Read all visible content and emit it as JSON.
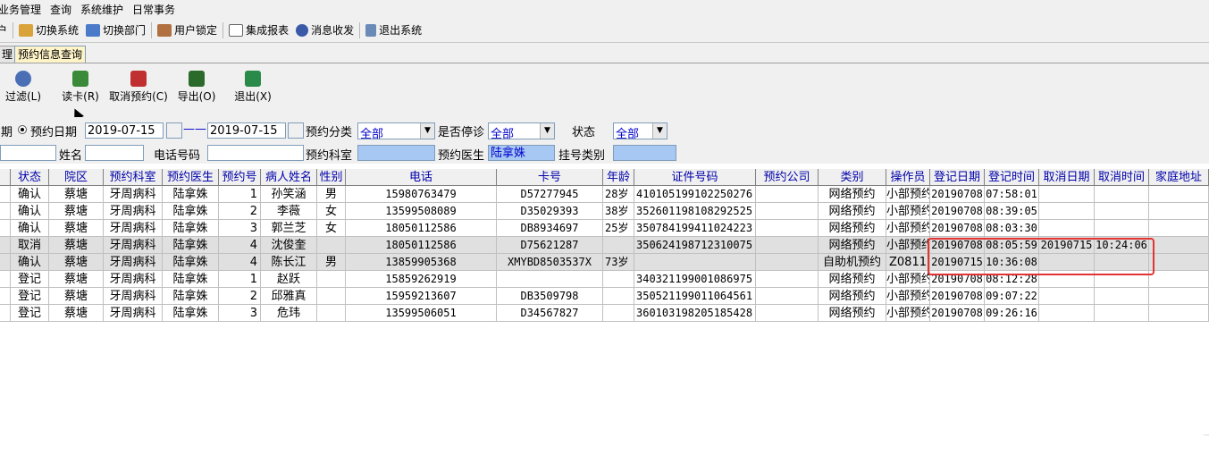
{
  "menu": [
    "业务管理",
    "查询",
    "系统维护",
    "日常事务"
  ],
  "toolbar": [
    {
      "label": "户",
      "icon": "user-icon"
    },
    {
      "label": "切换系统",
      "icon": "switch-system-icon"
    },
    {
      "label": "切换部门",
      "icon": "switch-dept-icon"
    },
    {
      "label": "用户锁定",
      "icon": "lock-user-icon"
    },
    {
      "label": "集成报表",
      "icon": "report-icon"
    },
    {
      "label": "消息收发",
      "icon": "info-icon"
    },
    {
      "label": "退出系统",
      "icon": "exit-icon"
    }
  ],
  "tabs": [
    "理",
    "预约信息查询"
  ],
  "actions": [
    {
      "label": "过滤(L)",
      "icon": "filter-icon",
      "color": "#4a6fb5"
    },
    {
      "label": "读卡(R)",
      "icon": "read-card-icon",
      "color": "#3a8a3a"
    },
    {
      "label": "取消预约(C)",
      "icon": "cancel-icon",
      "color": "#c03030"
    },
    {
      "label": "导出(O)",
      "icon": "export-icon",
      "color": "#2a6a2a"
    },
    {
      "label": "退出(X)",
      "icon": "quit-icon",
      "color": "#2a8a4a"
    }
  ],
  "filters": {
    "date_prefix": "期",
    "date_label": "预约日期",
    "date_from": "2019-07-15",
    "date_sep": "——",
    "date_to": "2019-07-15",
    "category_label": "预约分类",
    "category_value": "全部",
    "stop_label": "是否停诊",
    "stop_value": "全部",
    "status_label": "状态",
    "status_value": "全部",
    "name_label": "姓名",
    "phone_label": "电话号码",
    "dept_label": "预约科室",
    "doctor_label": "预约医生",
    "doctor_value": "陆拿姝",
    "reg_type_label": "挂号类别"
  },
  "columns": [
    "状态",
    "院区",
    "预约科室",
    "预约医生",
    "预约号",
    "病人姓名",
    "性别",
    "电话",
    "卡号",
    "年龄",
    "证件号码",
    "预约公司",
    "类别",
    "操作员",
    "登记日期",
    "登记时间",
    "取消日期",
    "取消时间",
    "家庭地址"
  ],
  "rows": [
    [
      "确认",
      "蔡塘",
      "牙周病科",
      "陆拿姝",
      "1",
      "孙笑涵",
      "男",
      "15980763479",
      "D57277945",
      "28岁",
      "410105199102250276",
      "",
      "网络预约",
      "小部预约",
      "20190708",
      "07:58:01",
      "",
      "",
      ""
    ],
    [
      "确认",
      "蔡塘",
      "牙周病科",
      "陆拿姝",
      "2",
      "李薇",
      "女",
      "13599508089",
      "D35029393",
      "38岁",
      "352601198108292525",
      "",
      "网络预约",
      "小部预约",
      "20190708",
      "08:39:05",
      "",
      "",
      ""
    ],
    [
      "确认",
      "蔡塘",
      "牙周病科",
      "陆拿姝",
      "3",
      "郭兰芝",
      "女",
      "18050112586",
      "DB8934697",
      "25岁",
      "350784199411024223",
      "",
      "网络预约",
      "小部预约",
      "20190708",
      "08:03:30",
      "",
      "",
      ""
    ],
    [
      "取消",
      "蔡塘",
      "牙周病科",
      "陆拿姝",
      "4",
      "沈俊奎",
      "",
      "18050112586",
      "D75621287",
      "",
      "350624198712310075",
      "",
      "网络预约",
      "小部预约",
      "20190708",
      "08:05:59",
      "20190715",
      "10:24:06",
      ""
    ],
    [
      "确认",
      "蔡塘",
      "牙周病科",
      "陆拿姝",
      "4",
      "陈长江",
      "男",
      "13859905368",
      "XMYBD8503537X",
      "73岁",
      "",
      "",
      "自助机预约",
      "Z0811",
      "20190715",
      "10:36:08",
      "",
      "",
      ""
    ],
    [
      "登记",
      "蔡塘",
      "牙周病科",
      "陆拿姝",
      "1",
      "赵跃",
      "",
      "15859262919",
      "",
      "",
      "340321199001086975",
      "",
      "网络预约",
      "小部预约",
      "20190708",
      "08:12:28",
      "",
      "",
      ""
    ],
    [
      "登记",
      "蔡塘",
      "牙周病科",
      "陆拿姝",
      "2",
      "邱雅真",
      "",
      "15959213607",
      "DB3509798",
      "",
      "350521199011064561",
      "",
      "网络预约",
      "小部预约",
      "20190708",
      "09:07:22",
      "",
      "",
      ""
    ],
    [
      "登记",
      "蔡塘",
      "牙周病科",
      "陆拿姝",
      "3",
      "危玮",
      "",
      "13599506051",
      "D34567827",
      "",
      "360103198205185428",
      "",
      "网络预约",
      "小部预约",
      "20190708",
      "09:26:16",
      "",
      "",
      ""
    ]
  ],
  "colors": {
    "highlight": "#e33434",
    "header_text": "#0000aa",
    "selected_bg": "#a7c8f2"
  }
}
